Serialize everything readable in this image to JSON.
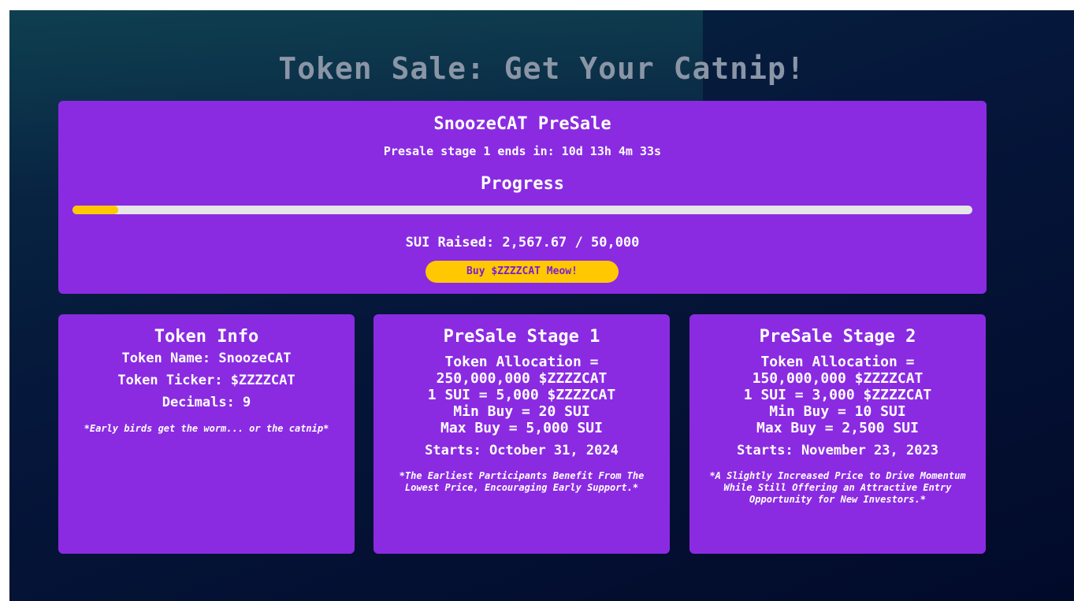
{
  "page": {
    "title": "Token Sale: Get Your Catnip!"
  },
  "presale": {
    "title": "SnoozeCAT PreSale",
    "countdown": "Presale stage 1 ends in: 10d 13h 4m 33s",
    "progress_label": "Progress",
    "progress_percent": 5.1,
    "raised_text": "SUI Raised: 2,567.67 / 50,000",
    "buy_label": "Buy $ZZZZCAT Meow!"
  },
  "token_info": {
    "title": "Token Info",
    "name": "Token Name: SnoozeCAT",
    "ticker": "Token Ticker: $ZZZZCAT",
    "decimals": "Decimals: 9",
    "note": "*Early birds get the worm... or the catnip*"
  },
  "stage1": {
    "title": "PreSale Stage 1",
    "allocation_label": "Token Allocation =",
    "allocation_value": "250,000,000 $ZZZZCAT",
    "rate": "1 SUI = 5,000 $ZZZZCAT",
    "min_buy": "Min Buy = 20 SUI",
    "max_buy": "Max Buy = 5,000 SUI",
    "starts": "Starts: October 31, 2024",
    "note": "*The Earliest Participants Benefit From The Lowest Price, Encouraging Early Support.*"
  },
  "stage2": {
    "title": "PreSale Stage 2",
    "allocation_label": "Token Allocation =",
    "allocation_value": "150,000,000 $ZZZZCAT",
    "rate": "1 SUI = 3,000 $ZZZZCAT",
    "min_buy": "Min Buy = 10 SUI",
    "max_buy": "Max Buy = 2,500 SUI",
    "starts": "Starts: November 23, 2023",
    "note": "*A Slightly Increased Price to Drive Momentum While Still Offering an Attractive Entry Opportunity for New Investors.*"
  },
  "colors": {
    "card": "#8a2be2",
    "accent": "#ffc800",
    "title": "#8a95a6",
    "background": "#05163a"
  }
}
